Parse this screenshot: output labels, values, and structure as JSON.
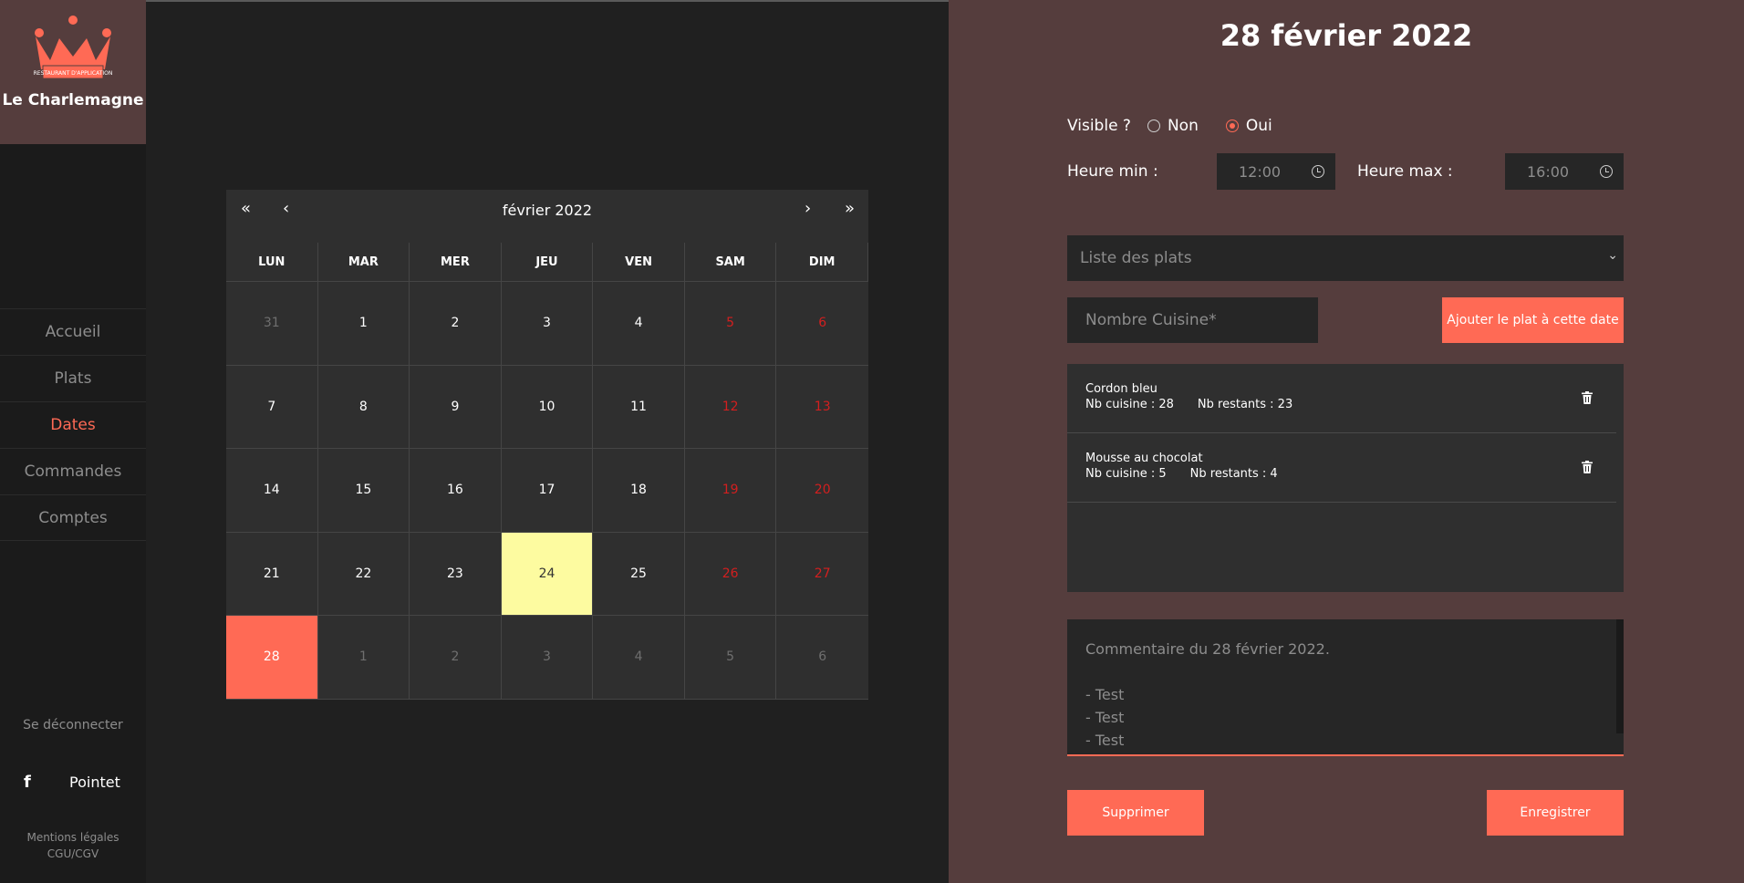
{
  "sidebar": {
    "brand_name": "Le Charlemagne",
    "logo_banner": "RESTAURANT D'APPLICATION",
    "nav": [
      {
        "label": "Accueil"
      },
      {
        "label": "Plats"
      },
      {
        "label": "Dates"
      },
      {
        "label": "Commandes"
      },
      {
        "label": "Comptes"
      }
    ],
    "logout": "Se déconnecter",
    "social_label": "Pointet",
    "legal_1": "Mentions légales",
    "legal_2": "CGU/CGV"
  },
  "calendar": {
    "month_title": "février 2022",
    "nav_first": "«",
    "nav_prev": "‹",
    "nav_next": "›",
    "nav_last": "»",
    "weekdays": [
      "LUN",
      "MAR",
      "MER",
      "JEU",
      "VEN",
      "SAM",
      "DIM"
    ],
    "days": [
      {
        "n": "31",
        "type": "muted"
      },
      {
        "n": "1",
        "type": "normal"
      },
      {
        "n": "2",
        "type": "normal"
      },
      {
        "n": "3",
        "type": "normal"
      },
      {
        "n": "4",
        "type": "normal"
      },
      {
        "n": "5",
        "type": "weekend"
      },
      {
        "n": "6",
        "type": "weekend"
      },
      {
        "n": "7",
        "type": "normal"
      },
      {
        "n": "8",
        "type": "normal"
      },
      {
        "n": "9",
        "type": "normal"
      },
      {
        "n": "10",
        "type": "normal"
      },
      {
        "n": "11",
        "type": "normal"
      },
      {
        "n": "12",
        "type": "weekend"
      },
      {
        "n": "13",
        "type": "weekend"
      },
      {
        "n": "14",
        "type": "normal"
      },
      {
        "n": "15",
        "type": "normal"
      },
      {
        "n": "16",
        "type": "normal"
      },
      {
        "n": "17",
        "type": "normal"
      },
      {
        "n": "18",
        "type": "normal"
      },
      {
        "n": "19",
        "type": "weekend"
      },
      {
        "n": "20",
        "type": "weekend"
      },
      {
        "n": "21",
        "type": "normal"
      },
      {
        "n": "22",
        "type": "normal"
      },
      {
        "n": "23",
        "type": "normal"
      },
      {
        "n": "24",
        "type": "today"
      },
      {
        "n": "25",
        "type": "normal"
      },
      {
        "n": "26",
        "type": "weekend"
      },
      {
        "n": "27",
        "type": "weekend"
      },
      {
        "n": "28",
        "type": "selected"
      },
      {
        "n": "1",
        "type": "muted"
      },
      {
        "n": "2",
        "type": "muted"
      },
      {
        "n": "3",
        "type": "muted"
      },
      {
        "n": "4",
        "type": "muted"
      },
      {
        "n": "5",
        "type": "muted"
      },
      {
        "n": "6",
        "type": "muted"
      }
    ]
  },
  "panel": {
    "title": "28 février 2022",
    "visible_label": "Visible ?",
    "option_non": "Non",
    "option_oui": "Oui",
    "visible_value": "Oui",
    "heure_min_label": "Heure min :",
    "heure_min_value": "12:00",
    "heure_max_label": "Heure max :",
    "heure_max_value": "16:00",
    "dish_select_placeholder": "Liste des plats",
    "count_placeholder": "Nombre Cuisine*",
    "add_button": "Ajouter le plat à cette date",
    "dishes": [
      {
        "name": "Cordon bleu",
        "cuisine": "Nb cuisine : 28",
        "restants": "Nb restants : 23"
      },
      {
        "name": "Mousse au chocolat",
        "cuisine": "Nb cuisine : 5",
        "restants": "Nb restants : 4"
      }
    ],
    "comment_lines": [
      "Commentaire du 28 février 2022.",
      "",
      "- Test",
      "- Test",
      "- Test"
    ],
    "delete_button": "Supprimer",
    "save_button": "Enregistrer"
  },
  "colors": {
    "accent": "#ff6a55",
    "panel_bg": "#553d3d",
    "today_bg": "#fdfba0",
    "weekend_text": "#d31f1f"
  }
}
